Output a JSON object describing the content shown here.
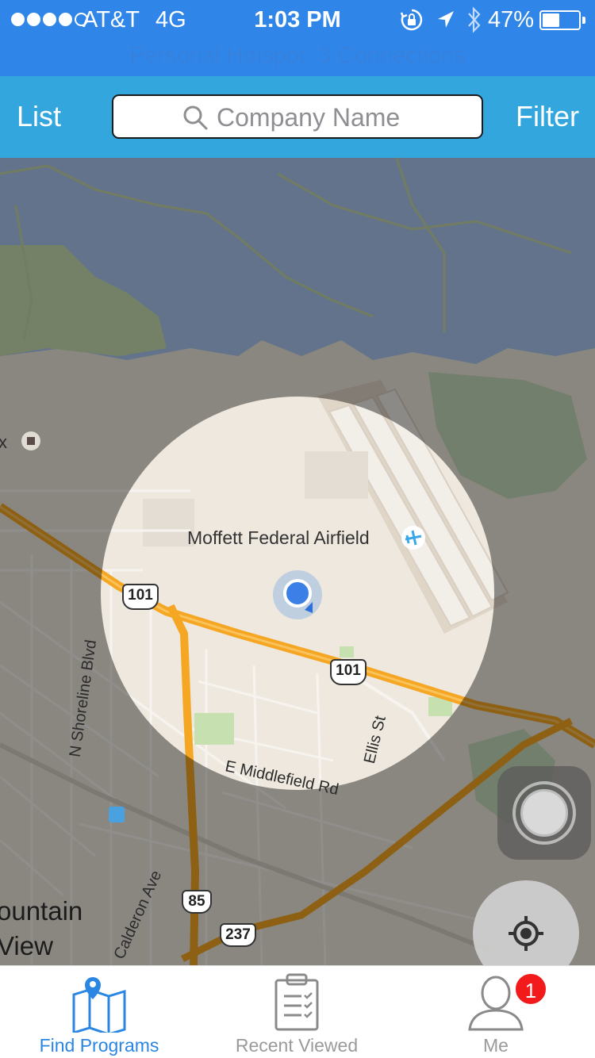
{
  "status_bar": {
    "carrier": "AT&T",
    "network": "4G",
    "time": "1:03 PM",
    "battery_percent": "47%",
    "battery_level": 0.47,
    "signal_bars_filled": 4,
    "signal_bars_total": 5,
    "hotspot_text": "Personal Hotspot: 3 Connections",
    "icons": [
      "rotation-lock-icon",
      "location-arrow-icon",
      "bluetooth-icon"
    ],
    "color": "#2f86e8"
  },
  "nav": {
    "left_button": "List",
    "right_button": "Filter",
    "search_placeholder": "Company Name",
    "search_value": "",
    "color": "#33a6de"
  },
  "map": {
    "airfield_label": "Moffett Federal Airfield",
    "highway_101": "101",
    "highway_85": "85",
    "highway_237": "237",
    "streets": {
      "shoreline": "N Shoreline Blvd",
      "ellis": "Ellis St",
      "middlefield": "E Middlefield Rd",
      "calderon": "Calderon Ave"
    },
    "city_line1": "ountain",
    "city_line2": "View",
    "edge_label": "x"
  },
  "tabs": [
    {
      "label": "Find Programs",
      "icon": "map-pin-icon",
      "active": true
    },
    {
      "label": "Recent Viewed",
      "icon": "clipboard-checklist-icon",
      "active": false
    },
    {
      "label": "Me",
      "icon": "user-icon",
      "active": false,
      "badge": "1"
    }
  ],
  "accent_color": "#2a86e3"
}
